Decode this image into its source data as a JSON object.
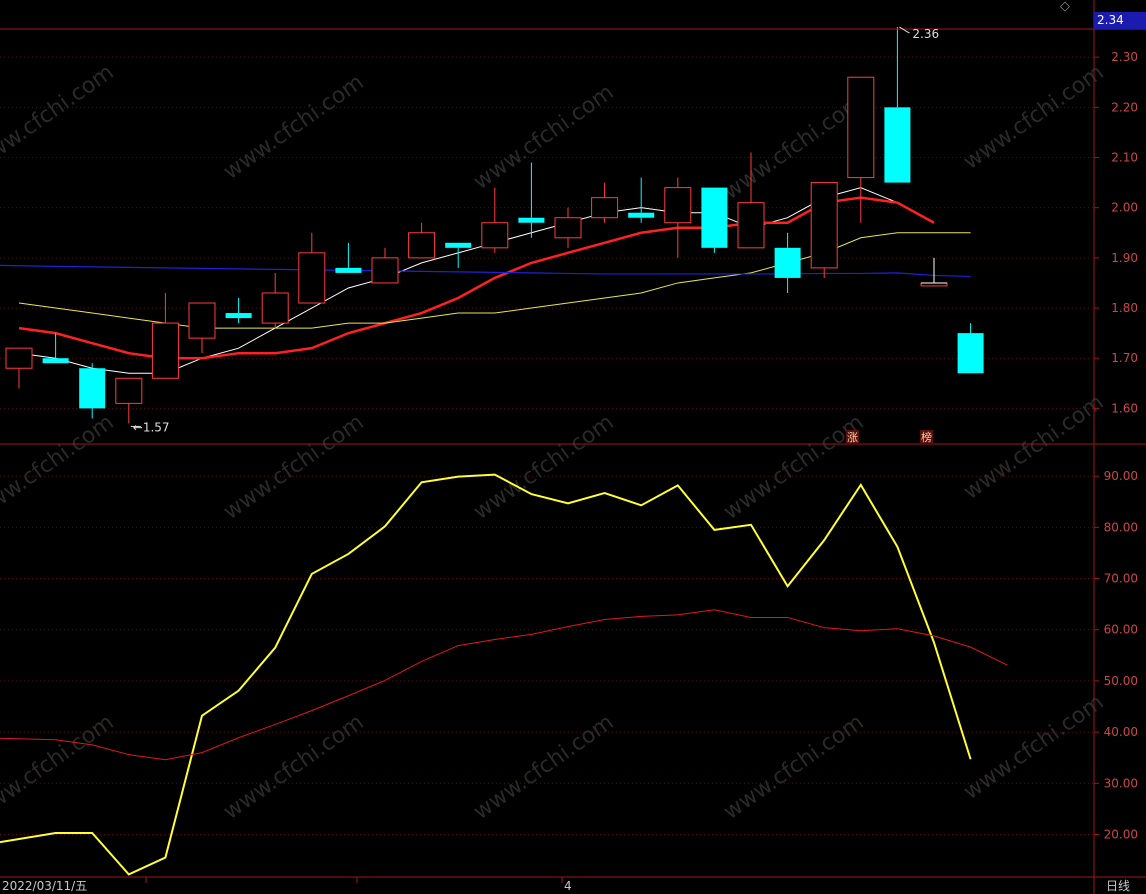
{
  "header": {
    "current_price": "2.34",
    "corner_icon": "diamond-icon"
  },
  "footer": {
    "start_date": "2022/03/11/五",
    "month_marker": "4",
    "period": "日线"
  },
  "watermark": "www.cfchi.com",
  "markers": {
    "zhang": "涨",
    "bang": "榜"
  },
  "colors": {
    "up": "#ff3c3c",
    "down": "#00ffff",
    "ma5": "#ffffff",
    "ma10": "#ff2020",
    "ma20": "#e8e84a",
    "ma60": "#1e22d8",
    "indicator": "#ffff33",
    "indicator_ma": "#e01818",
    "axis": "#a01616",
    "tick_text": "#c84848"
  },
  "chart_data": [
    {
      "type": "candlestick",
      "title": "",
      "y_ticks": [
        "1.60",
        "1.70",
        "1.80",
        "1.90",
        "2.00",
        "2.10",
        "2.20",
        "2.30"
      ],
      "ylim": [
        1.535,
        2.39
      ],
      "high_label": "2.36",
      "low_label": "1.57",
      "candles": [
        {
          "o": 1.68,
          "h": 1.72,
          "l": 1.64,
          "c": 1.72
        },
        {
          "o": 1.7,
          "h": 1.75,
          "l": 1.69,
          "c": 1.69
        },
        {
          "o": 1.68,
          "h": 1.69,
          "l": 1.58,
          "c": 1.6
        },
        {
          "o": 1.61,
          "h": 1.66,
          "l": 1.57,
          "c": 1.66
        },
        {
          "o": 1.66,
          "h": 1.83,
          "l": 1.66,
          "c": 1.77
        },
        {
          "o": 1.74,
          "h": 1.81,
          "l": 1.71,
          "c": 1.81
        },
        {
          "o": 1.79,
          "h": 1.82,
          "l": 1.77,
          "c": 1.78
        },
        {
          "o": 1.77,
          "h": 1.87,
          "l": 1.76,
          "c": 1.83
        },
        {
          "o": 1.81,
          "h": 1.95,
          "l": 1.81,
          "c": 1.91
        },
        {
          "o": 1.88,
          "h": 1.93,
          "l": 1.87,
          "c": 1.87
        },
        {
          "o": 1.85,
          "h": 1.92,
          "l": 1.85,
          "c": 1.9
        },
        {
          "o": 1.9,
          "h": 1.97,
          "l": 1.9,
          "c": 1.95
        },
        {
          "o": 1.93,
          "h": 1.93,
          "l": 1.88,
          "c": 1.92
        },
        {
          "o": 1.92,
          "h": 2.04,
          "l": 1.91,
          "c": 1.97
        },
        {
          "o": 1.98,
          "h": 2.09,
          "l": 1.94,
          "c": 1.97
        },
        {
          "o": 1.94,
          "h": 2.0,
          "l": 1.92,
          "c": 1.98
        },
        {
          "o": 1.98,
          "h": 2.05,
          "l": 1.97,
          "c": 2.02
        },
        {
          "o": 1.99,
          "h": 2.06,
          "l": 1.97,
          "c": 1.98
        },
        {
          "o": 1.97,
          "h": 2.06,
          "l": 1.9,
          "c": 2.04
        },
        {
          "o": 2.04,
          "h": 2.04,
          "l": 1.91,
          "c": 1.92
        },
        {
          "o": 1.92,
          "h": 2.11,
          "l": 1.92,
          "c": 2.01
        },
        {
          "o": 1.92,
          "h": 1.95,
          "l": 1.83,
          "c": 1.86
        },
        {
          "o": 1.88,
          "h": 2.05,
          "l": 1.86,
          "c": 2.05
        },
        {
          "o": 2.06,
          "h": 2.26,
          "l": 1.97,
          "c": 2.26
        },
        {
          "o": 2.2,
          "h": 2.36,
          "l": 2.05,
          "c": 2.05
        },
        {
          "o": 1.85,
          "h": 1.9,
          "l": 1.85,
          "c": 1.85
        },
        {
          "o": 1.75,
          "h": 1.77,
          "l": 1.67,
          "c": 1.67
        }
      ],
      "series": [
        {
          "values": [
            1.71,
            1.7,
            1.68,
            1.67,
            1.67,
            1.7,
            1.72,
            1.76,
            1.8,
            1.84,
            1.86,
            1.89,
            1.91,
            1.93,
            1.95,
            1.97,
            1.99,
            2.0,
            1.99,
            1.99,
            1.96,
            1.98,
            2.02,
            2.04,
            2.01,
            1.97
          ]
        },
        {
          "values": [
            1.76,
            1.75,
            1.73,
            1.71,
            1.7,
            1.7,
            1.71,
            1.71,
            1.72,
            1.75,
            1.77,
            1.79,
            1.82,
            1.86,
            1.89,
            1.91,
            1.93,
            1.95,
            1.96,
            1.96,
            1.97,
            1.97,
            2.01,
            2.02,
            2.01,
            1.97
          ]
        },
        {
          "values": [
            1.81,
            1.8,
            1.79,
            1.78,
            1.77,
            1.76,
            1.76,
            1.76,
            1.76,
            1.77,
            1.77,
            1.78,
            1.79,
            1.79,
            1.8,
            1.81,
            1.82,
            1.83,
            1.85,
            1.86,
            1.87,
            1.89,
            1.91,
            1.94,
            1.95,
            1.95,
            1.95
          ]
        },
        {
          "values": [
            1.885,
            1.883,
            1.882,
            1.881,
            1.88,
            1.879,
            1.878,
            1.877,
            1.876,
            1.875,
            1.874,
            1.873,
            1.872,
            1.871,
            1.87,
            1.869,
            1.868,
            1.868,
            1.868,
            1.868,
            1.868,
            1.868,
            1.869,
            1.869,
            1.87,
            1.865,
            1.863
          ]
        }
      ]
    },
    {
      "type": "line",
      "title": "",
      "y_ticks": [
        "20.00",
        "30.00",
        "40.00",
        "50.00",
        "60.00",
        "70.00",
        "80.00",
        "90.00"
      ],
      "ylim": [
        11.5,
        95.5
      ],
      "series": [
        {
          "values": [
            18.5,
            20.3,
            20.3,
            12.2,
            15.5,
            43.2,
            48.1,
            56.5,
            70.9,
            74.8,
            80.2,
            88.8,
            89.9,
            90.3,
            86.5,
            84.7,
            86.7,
            84.3,
            88.2,
            79.5,
            80.5,
            68.5,
            77.5,
            88.3,
            76.2,
            57.5,
            34.7
          ]
        },
        {
          "values": [
            38.8,
            38.5,
            37.5,
            35.6,
            34.6,
            36.0,
            38.9,
            41.5,
            44.2,
            47.1,
            50.1,
            53.8,
            56.9,
            58.1,
            59.1,
            60.6,
            62.0,
            62.6,
            62.9,
            63.9,
            62.4,
            62.4,
            60.4,
            59.8,
            60.2,
            58.8,
            56.6,
            53.1
          ]
        }
      ]
    }
  ]
}
